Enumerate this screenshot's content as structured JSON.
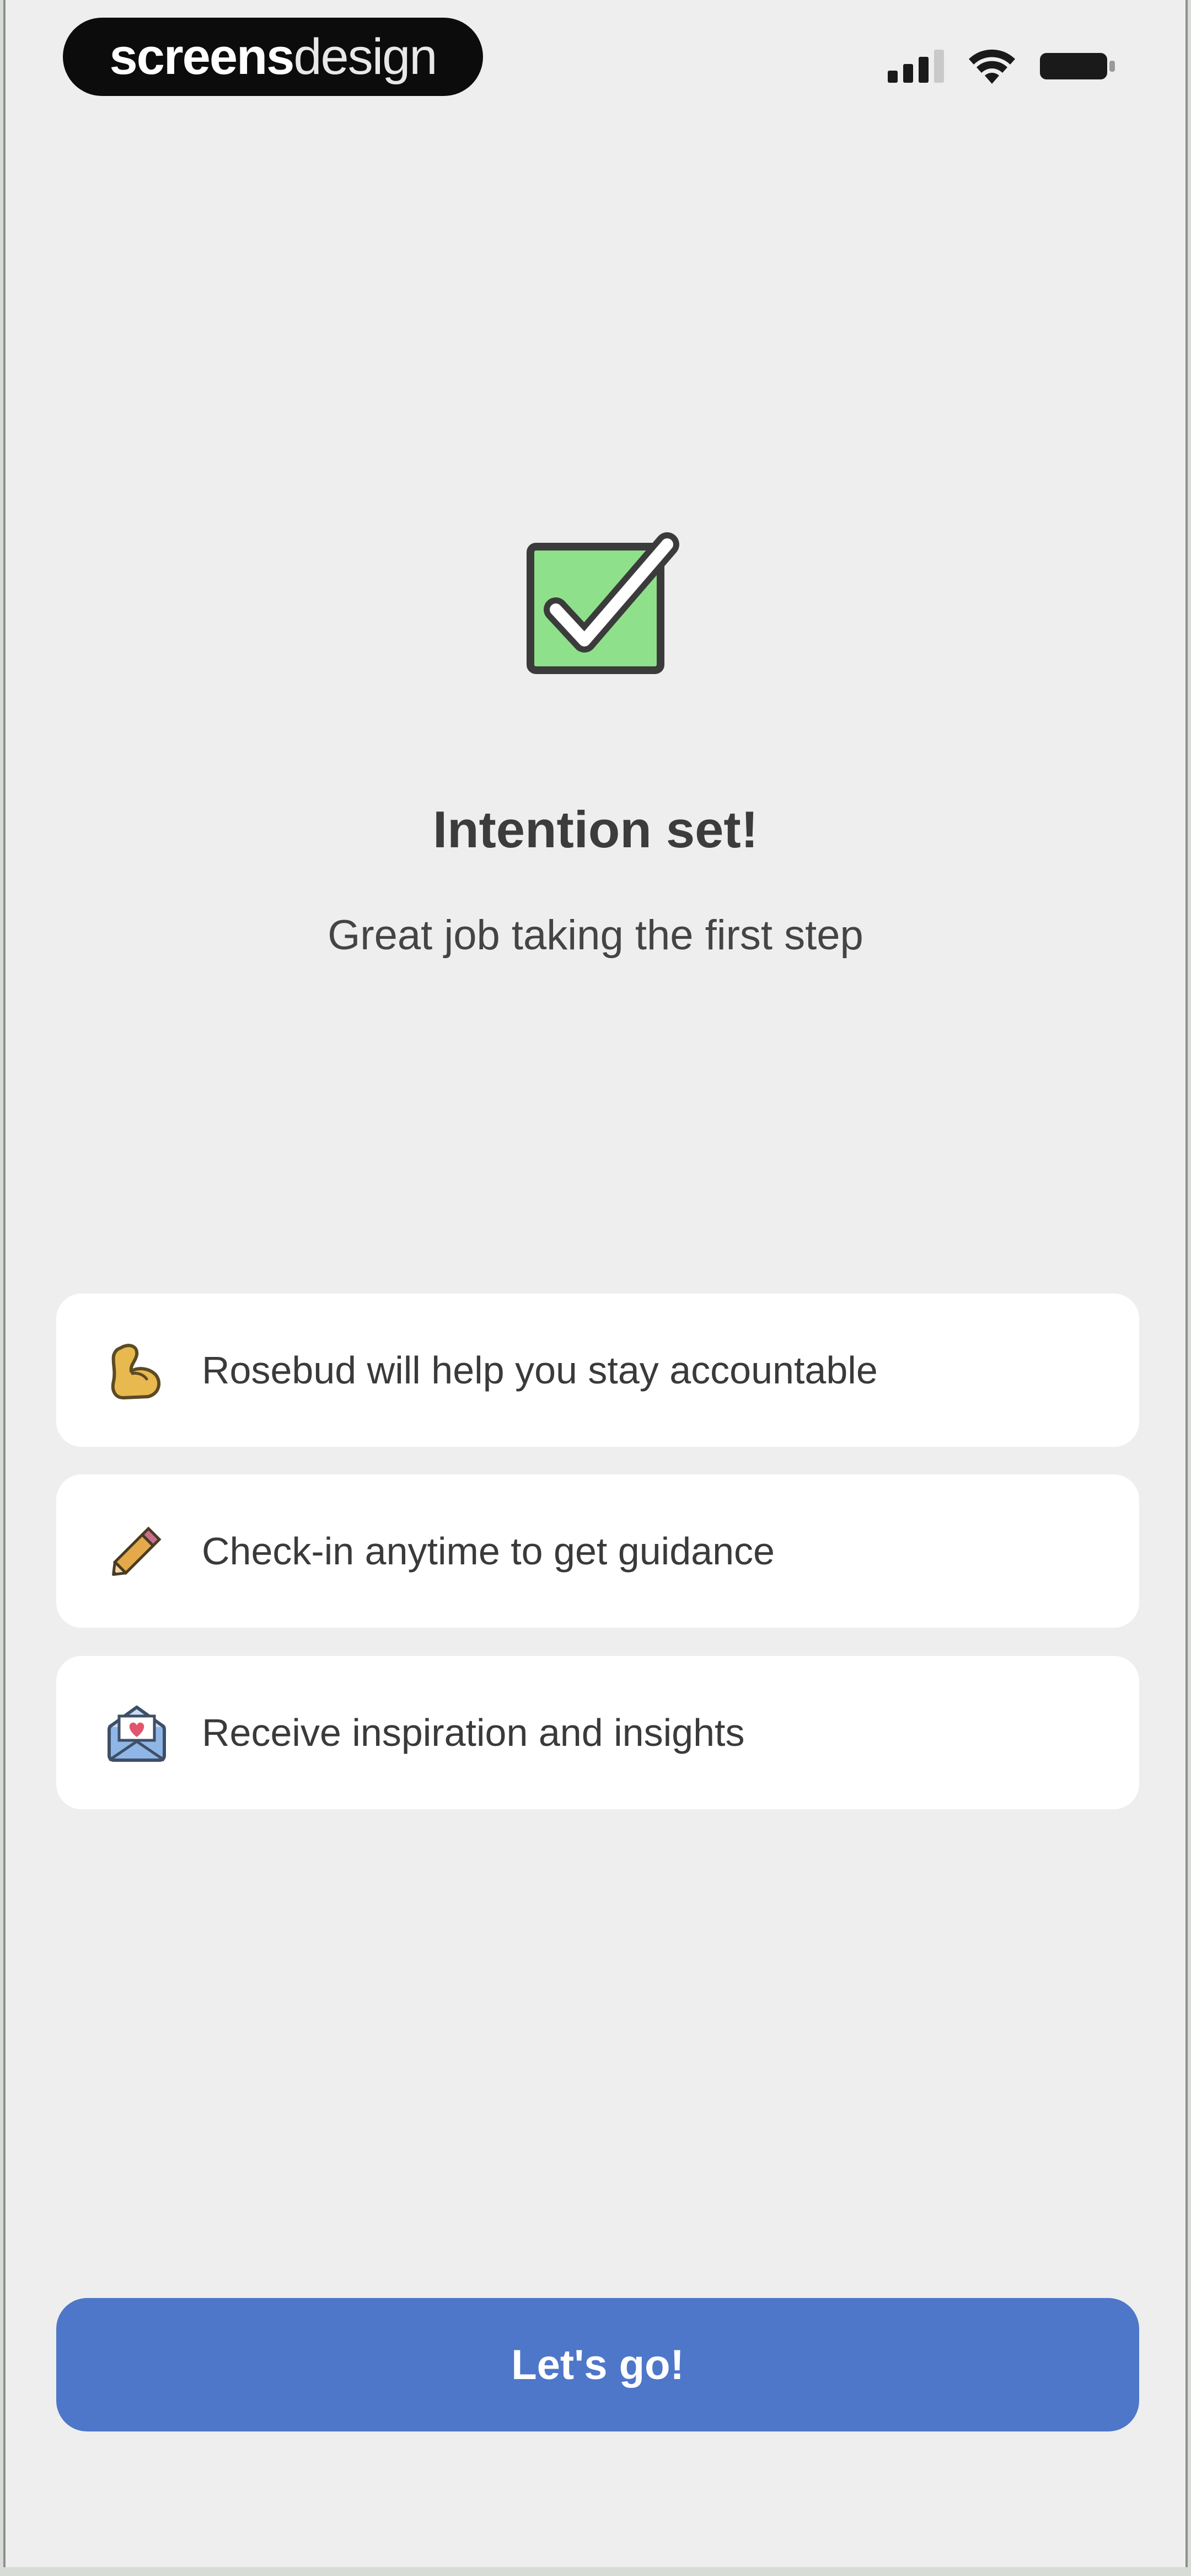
{
  "status_bar": {
    "brand_part1": "screens",
    "brand_part2": "design",
    "icons": [
      "signal-icon",
      "wifi-icon",
      "battery-icon"
    ]
  },
  "hero": {
    "icon": "check-box-icon",
    "title": "Intention set!",
    "subtitle": "Great job taking the first step"
  },
  "features": [
    {
      "icon": "flexed-biceps-icon",
      "label": "Rosebud will help you stay accountable"
    },
    {
      "icon": "pencil-icon",
      "label": "Check-in anytime to get guidance"
    },
    {
      "icon": "envelope-heart-icon",
      "label": "Receive inspiration and insights"
    }
  ],
  "cta": {
    "label": "Let's go!"
  },
  "colors": {
    "background": "#eeeeee",
    "card": "#ffffff",
    "accent": "#4e77c9",
    "check_green": "#8fe08a",
    "text_dark": "#3c3c3c"
  }
}
